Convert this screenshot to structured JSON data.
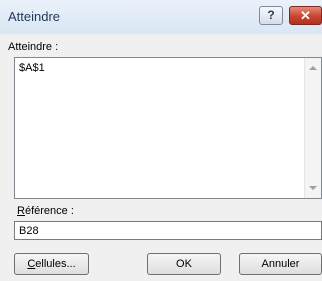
{
  "window": {
    "title": "Atteindre",
    "help_label": "?",
    "close_label": "✕"
  },
  "goto": {
    "label": "Atteindre :",
    "items": [
      "$A$1"
    ]
  },
  "reference": {
    "label_mnemonic": "R",
    "label_rest": "éférence :",
    "value": "B28"
  },
  "buttons": {
    "cells_mnemonic": "C",
    "cells_rest": "ellules...",
    "ok": "OK",
    "cancel": "Annuler"
  }
}
